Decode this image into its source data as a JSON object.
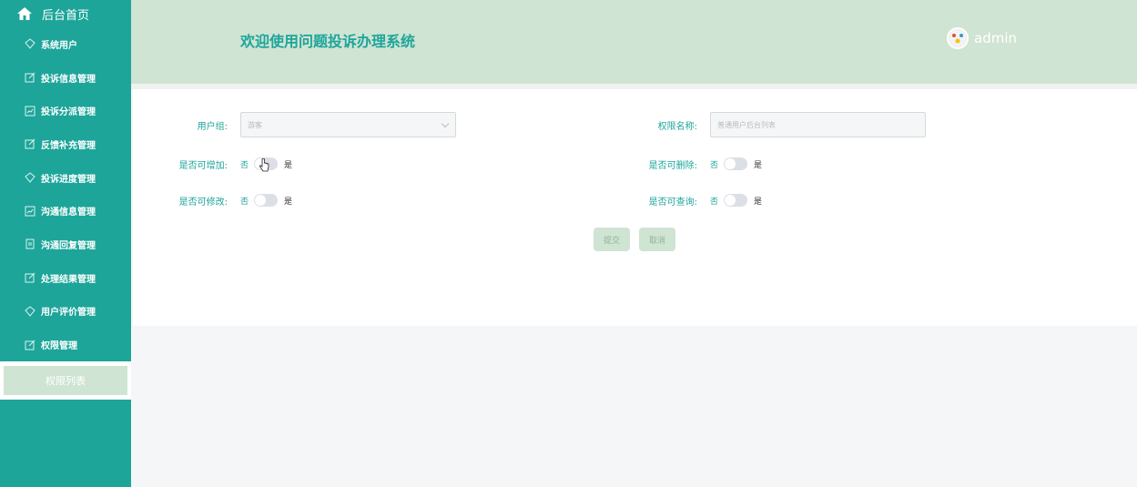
{
  "sidebar": {
    "home_label": "后台首页",
    "items": [
      {
        "label": "系统用户",
        "icon": "diamond-icon"
      },
      {
        "label": "投诉信息管理",
        "icon": "edit-icon"
      },
      {
        "label": "投诉分派管理",
        "icon": "chart-icon"
      },
      {
        "label": "反馈补充管理",
        "icon": "edit-icon"
      },
      {
        "label": "投诉进度管理",
        "icon": "diamond-icon"
      },
      {
        "label": "沟通信息管理",
        "icon": "chart-icon"
      },
      {
        "label": "沟通回复管理",
        "icon": "doc-icon"
      },
      {
        "label": "处理结果管理",
        "icon": "edit-icon"
      },
      {
        "label": "用户评价管理",
        "icon": "diamond-icon"
      },
      {
        "label": "权限管理",
        "icon": "edit-icon"
      }
    ],
    "sub_item": "权限列表"
  },
  "header": {
    "title": "欢迎使用问题投诉办理系统",
    "user": "admin"
  },
  "form": {
    "user_group_label": "用户组:",
    "user_group_value": "游客",
    "perm_name_label": "权限名称:",
    "perm_name_placeholder": "普通用户后台列表",
    "can_add_label": "是否可增加:",
    "can_delete_label": "是否可删除:",
    "can_edit_label": "是否可修改:",
    "can_query_label": "是否可查询:",
    "no": "否",
    "yes": "是",
    "submit": "提交",
    "cancel": "取消"
  },
  "colors": {
    "primary": "#1da59a",
    "light": "#cfe4d3"
  }
}
